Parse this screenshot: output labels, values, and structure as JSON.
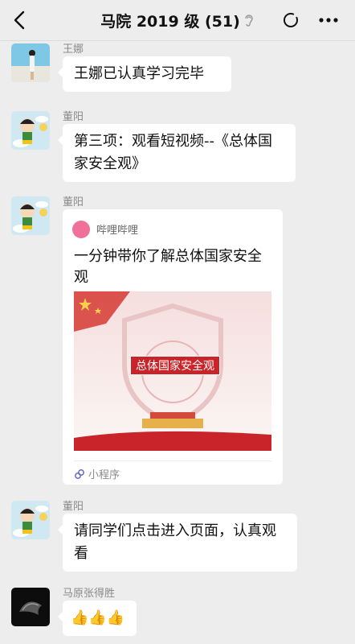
{
  "header": {
    "title": "马院 2019 级 (51)",
    "back_icon": "chevron-left-icon",
    "ear_icon": "ear-icon",
    "sync_icon": "circle-icon",
    "more_icon": "more-dots-icon"
  },
  "messages": [
    {
      "sender": "王娜",
      "text": "王娜已认真学习完毕",
      "avatar": "photo-avatar"
    },
    {
      "sender": "董阳",
      "text": "第三项：观看短视频--《总体国家安全观》",
      "avatar": "cartoon-avatar"
    },
    {
      "sender": "董阳",
      "avatar": "cartoon-avatar",
      "card": {
        "app_name": "哔哩哔哩",
        "title": "一分钟带你了解总体国家安全观",
        "thumbnail_text": "总体国家安全观",
        "footer": "小程序"
      }
    },
    {
      "sender": "董阳",
      "text": "请同学们点击进入页面，认真观看",
      "avatar": "cartoon-avatar"
    },
    {
      "sender": "马原张得胜",
      "text": "👍👍👍",
      "avatar": "dark-avatar"
    }
  ],
  "colors": {
    "background": "#ededed",
    "bubble": "#ffffff",
    "accent_red": "#c8242a",
    "bilibili_pink": "#f07099"
  }
}
